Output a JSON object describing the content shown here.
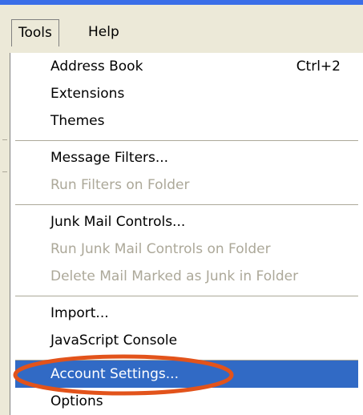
{
  "menubar": {
    "tools_label": "Tools",
    "help_label": "Help"
  },
  "menu": {
    "items": [
      {
        "label": "Address Book",
        "shortcut": "Ctrl+2",
        "enabled": true
      },
      {
        "label": "Extensions",
        "enabled": true
      },
      {
        "label": "Themes",
        "enabled": true
      },
      {
        "label": "Message Filters...",
        "enabled": true
      },
      {
        "label": "Run Filters on Folder",
        "enabled": false
      },
      {
        "label": "Junk Mail Controls...",
        "enabled": true
      },
      {
        "label": "Run Junk Mail Controls on Folder",
        "enabled": false
      },
      {
        "label": "Delete Mail Marked as Junk in Folder",
        "enabled": false
      },
      {
        "label": "Import...",
        "enabled": true
      },
      {
        "label": "JavaScript Console",
        "enabled": true
      },
      {
        "label": "Account Settings...",
        "enabled": true,
        "highlighted": true
      },
      {
        "label": "Options",
        "enabled": true
      }
    ]
  },
  "colors": {
    "highlight": "#316ac5",
    "disabled_text": "#aca899",
    "annotation_ellipse": "#e2531b",
    "titlebar_blue": "#3a6ee8"
  },
  "annotation": {
    "shape": "ellipse",
    "target": "Account Settings..."
  }
}
